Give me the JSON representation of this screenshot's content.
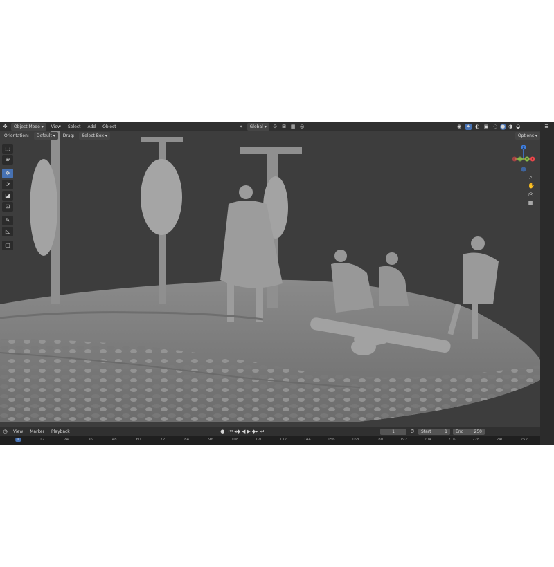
{
  "header": {
    "mode": "Object Mode",
    "menus": [
      "View",
      "Select",
      "Add",
      "Object"
    ],
    "transform_orientation": "Global",
    "options_label": "Options"
  },
  "tool_header": {
    "orientation_label": "Orientation:",
    "orientation_value": "Default",
    "drag_label": "Drag:",
    "drag_value": "Select Box"
  },
  "gizmo": {
    "axes": [
      "Y",
      "X",
      "Z"
    ],
    "colors": {
      "x": "#e8474a",
      "y": "#8bc34a",
      "z": "#3f7fe0"
    }
  },
  "timeline": {
    "menus": [
      "View",
      "Marker",
      "Playback"
    ],
    "current_frame": "1",
    "start_label": "Start",
    "start_value": "1",
    "end_label": "End",
    "end_value": "250",
    "ruler_ticks": [
      "1",
      "12",
      "24",
      "36",
      "48",
      "60",
      "72",
      "84",
      "96",
      "108",
      "120",
      "132",
      "144",
      "156",
      "168",
      "180",
      "192",
      "204",
      "216",
      "228",
      "240",
      "252"
    ]
  },
  "accent": "#4772b3"
}
